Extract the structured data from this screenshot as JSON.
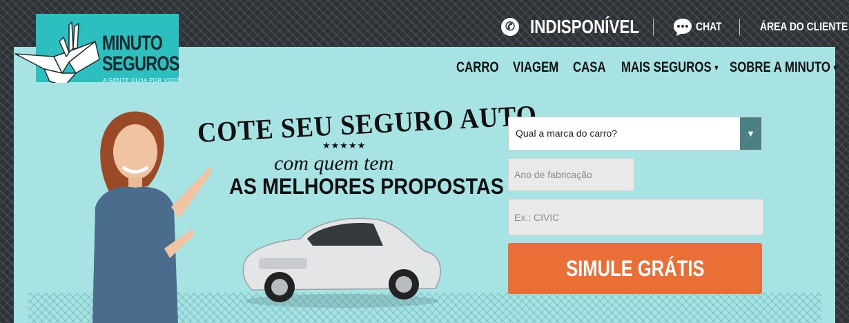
{
  "brand": {
    "name_line1": "MINUTO",
    "name_line2": "SEGUROS",
    "tagline": "A GENTE OLHA POR VOCÊ",
    "logo_bg": "#2dbfbf"
  },
  "topbar": {
    "phone_icon": "phone-icon",
    "phone_status": "INDISPONÍVEL",
    "chat_icon": "chat-bubble-icon",
    "chat_label": "CHAT",
    "client_area_label": "ÁREA DO CLIENTE"
  },
  "nav": {
    "items": [
      {
        "label": "CARRO",
        "has_dropdown": false
      },
      {
        "label": "VIAGEM",
        "has_dropdown": false
      },
      {
        "label": "CASA",
        "has_dropdown": false
      },
      {
        "label": "MAIS SEGUROS",
        "has_dropdown": true
      },
      {
        "label": "SOBRE A MINUTO",
        "has_dropdown": true
      }
    ],
    "caret": "▾"
  },
  "hero": {
    "headline_top": "COTE SEU SEGURO AUTO",
    "stars": "★★★★★",
    "headline_mid": "com quem tem",
    "headline_bottom": "AS MELHORES PROPOSTAS"
  },
  "form": {
    "brand_select": {
      "value": "Qual a marca do carro?",
      "icon": "chevron-down-icon"
    },
    "year_input": {
      "value": "",
      "placeholder": "Ano de fabricação"
    },
    "model_input": {
      "value": "",
      "placeholder": "Ex.: CIVIC"
    },
    "submit_label": "SIMULE GRÁTIS"
  },
  "colors": {
    "panel": "#a8e3e3",
    "header": "#2c3236",
    "cta": "#ea6f37",
    "select_btn": "#4b8182"
  }
}
